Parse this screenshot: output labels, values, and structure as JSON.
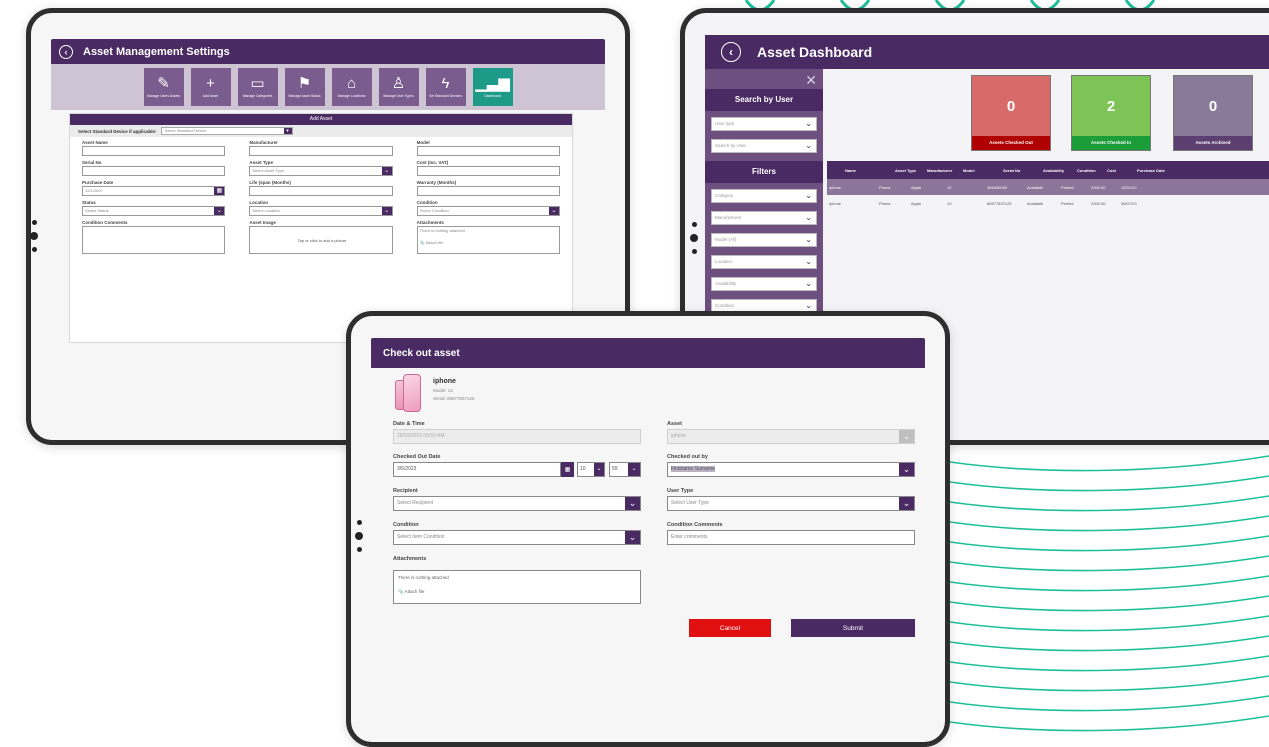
{
  "colors": {
    "purple": "#4a2a63",
    "teal": "#1fbf99",
    "red": "#e01010",
    "green_card": "#7ec356",
    "lavender_card": "#8a7a99",
    "rose_card": "#d86a6a"
  },
  "settings": {
    "title": "Asset Management Settings",
    "tools": [
      {
        "icon": "pencil-icon",
        "label": "Manage Users Assets"
      },
      {
        "icon": "plus-icon",
        "label": "Add Asset"
      },
      {
        "icon": "monitor-icon",
        "label": "Manage Categories"
      },
      {
        "icon": "flag-icon",
        "label": "Manage Asset Status"
      },
      {
        "icon": "location-icon",
        "label": "Manage Locations"
      },
      {
        "icon": "user-icon",
        "label": "Manage User Types"
      },
      {
        "icon": "lightning-icon",
        "label": "Set Standard Devices"
      },
      {
        "icon": "chart-icon",
        "label": "Dashboard"
      }
    ],
    "form": {
      "title": "Add Asset",
      "standard_label": "Select Standard Device if applicable:",
      "standard_placeholder": "Select Standard Device",
      "fields": [
        {
          "label": "Asset Name",
          "value": ""
        },
        {
          "label": "Manufacturer",
          "value": ""
        },
        {
          "label": "Model",
          "value": ""
        },
        {
          "label": "Serial No",
          "value": ""
        },
        {
          "label": "Asset Type",
          "value": "Select Asset Type"
        },
        {
          "label": "Cost (Inc. VAT)",
          "value": ""
        },
        {
          "label": "Purchase Date",
          "value": "12/1/2007"
        },
        {
          "label": "Life (span (Months)",
          "value": ""
        },
        {
          "label": "Warranty (Months)",
          "value": ""
        },
        {
          "label": "Status",
          "value": "Select Status"
        },
        {
          "label": "Location",
          "value": "Select Location"
        },
        {
          "label": "Condition",
          "value": "Select Condition"
        }
      ],
      "comments_label": "Condition Comments",
      "image_label": "Asset Image",
      "image_hint": "Tap or click to add a picture",
      "attachments_label": "Attachments",
      "attach_text": "There is nothing attached",
      "attach_file": "Attach file"
    }
  },
  "dashboard": {
    "title": "Asset Dashboard",
    "close_glyph": "✕",
    "search_heading": "Search by User",
    "search_selects": [
      "User type",
      "Search by User"
    ],
    "filters_heading": "Filters",
    "filter_selects": [
      "Category",
      "Manufacturer",
      "Model (All)",
      "Location",
      "Availability",
      "Condition"
    ],
    "stats": [
      {
        "value": "0",
        "label": "Assets Checked Out"
      },
      {
        "value": "2",
        "label": "Assets Checked In"
      },
      {
        "value": "0",
        "label": "Assets Archived"
      }
    ],
    "table": {
      "headers": [
        "Name",
        "Asset Type",
        "Manufacturer",
        "Model",
        "Serial No",
        "Availability",
        "Condition",
        "Cost",
        "Purchase Date"
      ],
      "rows": [
        [
          "iphone",
          "Phone",
          "Apple",
          "12",
          "381890000",
          "Available",
          "Perfect",
          "2300.00",
          "12/01/22"
        ],
        [
          "iphone",
          "Phone",
          "Apple",
          "13",
          "65977837125",
          "Available",
          "Perfect",
          "2300.00",
          "06/07/23"
        ]
      ]
    }
  },
  "checkout": {
    "title": "Check out asset",
    "item": {
      "name": "iphone",
      "model": "Model: 13",
      "serial": "Serial: 65977837125"
    },
    "date_time_label": "Date & Time",
    "date_time_value": "29/03/2023 09:59 AM",
    "asset_label": "Asset",
    "asset_value": "iphone",
    "checked_out_date_label": "Checked Out Date",
    "checked_out_date_value": "3/6/2023",
    "hour_value": "10",
    "minute_value": "59",
    "checked_out_by_label": "Checked out by",
    "checked_out_by_value": "Firstname Surname",
    "recipient_label": "Recipient",
    "recipient_placeholder": "Select Recipient",
    "user_type_label": "User Type",
    "user_type_placeholder": "Select User Type",
    "condition_label": "Condition",
    "condition_placeholder": "Select Item Condition",
    "condition_comments_label": "Condition Comments",
    "condition_comments_placeholder": "Enter comments",
    "attachments_label": "Attachments",
    "attach_text": "There is nothing attached",
    "attach_file": "Attach file",
    "cancel_label": "Cancel",
    "submit_label": "Submit"
  }
}
